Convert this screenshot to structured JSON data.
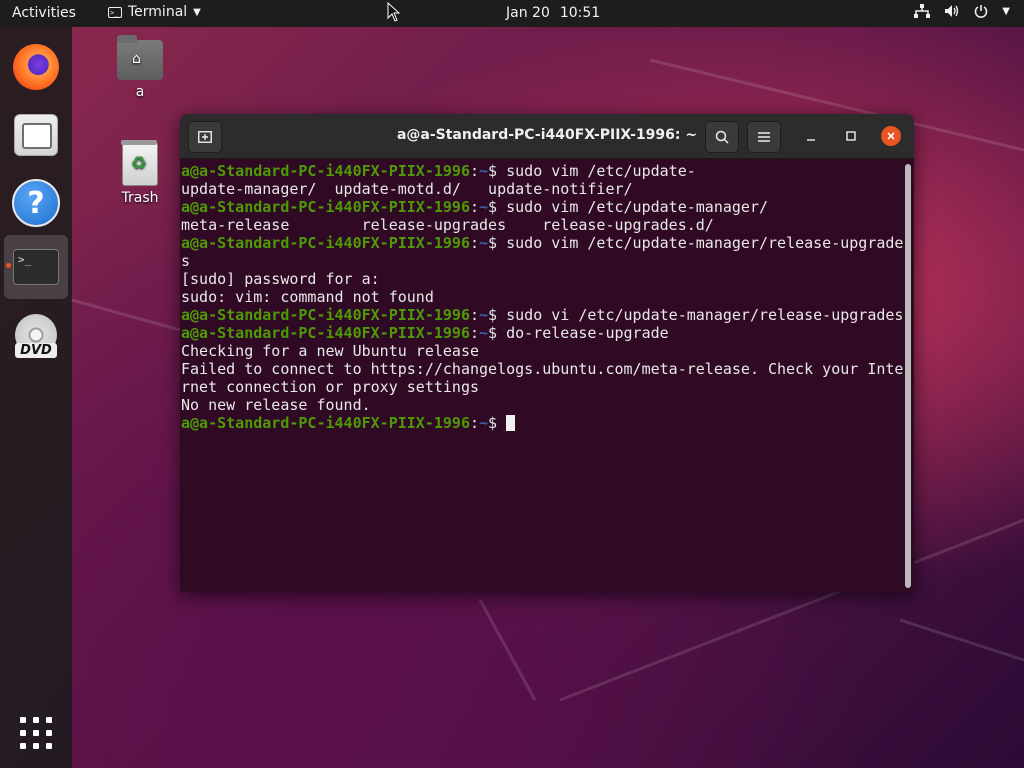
{
  "topbar": {
    "activities": "Activities",
    "app_menu_label": "Terminal",
    "date": "Jan 20",
    "time": "10:51",
    "tray_icons": [
      "network-icon",
      "volume-icon",
      "power-icon",
      "chevron-down-icon"
    ]
  },
  "dock": {
    "items": [
      "Firefox",
      "Files",
      "Help",
      "Terminal",
      "DVD"
    ],
    "active_item": "Terminal",
    "apps_grid": "Show Applications"
  },
  "desktop": {
    "home_label": "a",
    "trash_label": "Trash"
  },
  "terminal": {
    "title": "a@a-Standard-PC-i440FX-PIIX-1996: ~",
    "prompt_user": "a@a-Standard-PC-i440FX-PIIX-1996",
    "prompt_colon": ":",
    "prompt_path": "~",
    "prompt_dollar": "$ ",
    "lines": [
      {
        "type": "cmd",
        "text": "sudo vim /etc/update-"
      },
      {
        "type": "out",
        "text": "update-manager/  update-motd.d/   update-notifier/"
      },
      {
        "type": "cmd",
        "text": "sudo vim /etc/update-manager/"
      },
      {
        "type": "out",
        "text": "meta-release        release-upgrades    release-upgrades.d/"
      },
      {
        "type": "cmd",
        "text": "sudo vim /etc/update-manager/release-upgrade"
      },
      {
        "type": "out",
        "text": "s"
      },
      {
        "type": "out",
        "text": "[sudo] password for a:"
      },
      {
        "type": "out",
        "text": "sudo: vim: command not found"
      },
      {
        "type": "cmd",
        "text": "sudo vi /etc/update-manager/release-upgrades"
      },
      {
        "type": "cmd",
        "text": "do-release-upgrade"
      },
      {
        "type": "out",
        "text": "Checking for a new Ubuntu release"
      },
      {
        "type": "out",
        "text": "Failed to connect to https://changelogs.ubuntu.com/meta-release. Check your Inte"
      },
      {
        "type": "out",
        "text": "rnet connection or proxy settings"
      },
      {
        "type": "out",
        "text": "No new release found."
      },
      {
        "type": "cmd",
        "text": "",
        "cursor": true
      }
    ]
  },
  "colors": {
    "terminal_bg": "#300a24",
    "prompt_user": "#4e9a06",
    "prompt_path": "#3465a4",
    "accent": "#e95420"
  }
}
